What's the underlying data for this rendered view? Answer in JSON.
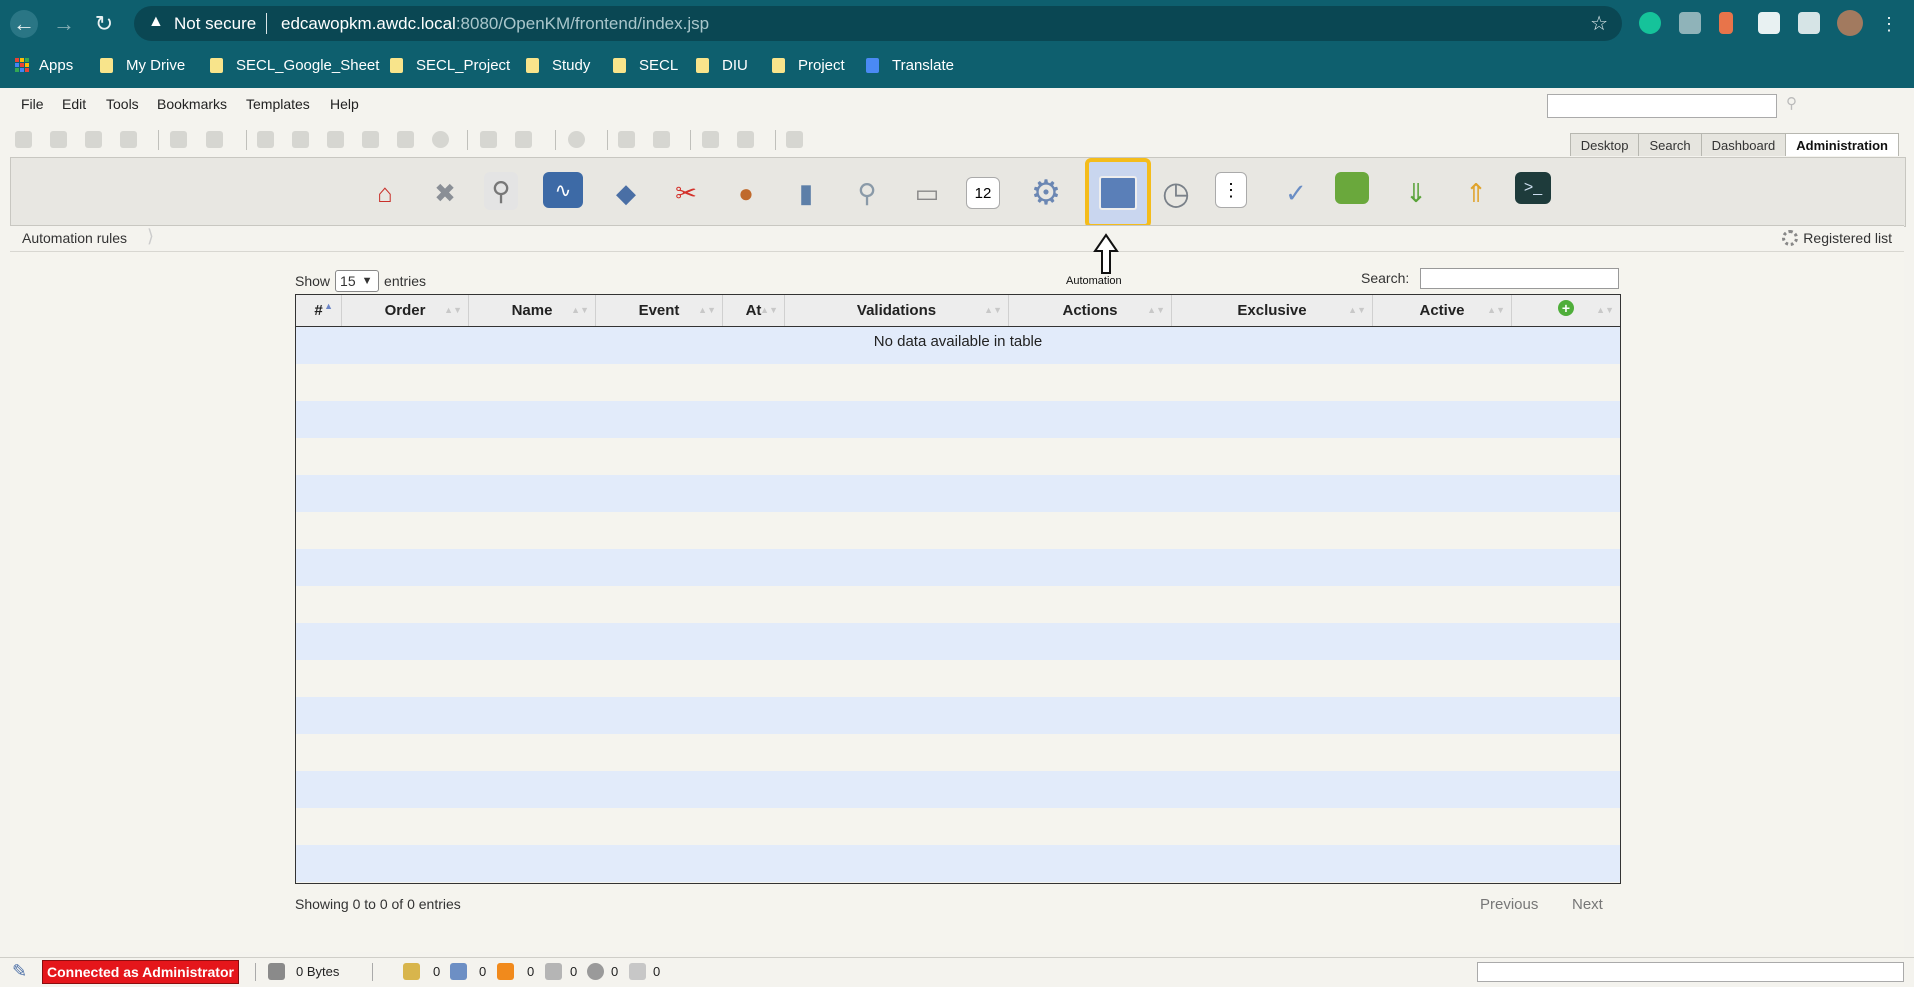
{
  "browser": {
    "security_label": "Not secure",
    "url_host": "edcawopkm.awdc.local",
    "url_rest": ":8080/OpenKM/frontend/index.jsp",
    "bookmarks": [
      "Apps",
      "My Drive",
      "SECL_Google_Sheet",
      "SECL_Project",
      "Study",
      "SECL",
      "DIU",
      "Project",
      "Translate"
    ]
  },
  "menubar": {
    "items": [
      "File",
      "Edit",
      "Tools",
      "Bookmarks",
      "Templates",
      "Help"
    ]
  },
  "tabs": [
    "Desktop",
    "Search",
    "Dashboard",
    "Administration"
  ],
  "active_tab": "Administration",
  "admin_tools": {
    "selected_tooltip": "Automation",
    "icons": [
      "home-icon",
      "tools-icon",
      "search-doc-icon",
      "monitor-icon",
      "workflow-icon",
      "scissors-icon",
      "users-icon",
      "database-icon",
      "magnifier-icon",
      "scanner-icon",
      "calendar-icon",
      "gear-icon",
      "automation-icon",
      "clock-icon",
      "list-icon",
      "brush-icon",
      "green-box-icon",
      "import-icon",
      "export-icon",
      "terminal-icon"
    ],
    "calendar_day": "12"
  },
  "breadcrumb": {
    "current": "Automation rules",
    "right_action": "Registered list"
  },
  "table_controls": {
    "show_label": "Show",
    "page_size": "15",
    "entries_label": "entries",
    "search_label": "Search:"
  },
  "table": {
    "columns": [
      "#",
      "Order",
      "Name",
      "Event",
      "At",
      "Validations",
      "Actions",
      "Exclusive",
      "Active"
    ],
    "empty_message": "No data available in table"
  },
  "footer": {
    "info": "Showing 0 to 0 of 0 entries",
    "previous": "Previous",
    "next": "Next"
  },
  "status": {
    "connected": "Connected as Administrator",
    "size": "0 Bytes",
    "counters": [
      "0",
      "0",
      "0",
      "0",
      "0",
      "0"
    ]
  },
  "colors": {
    "chrome": "#0e5f6e",
    "accent_selection": "#f4bc1b",
    "connected_bg": "#e5161b",
    "row_stripe": "#e2ebfa"
  }
}
